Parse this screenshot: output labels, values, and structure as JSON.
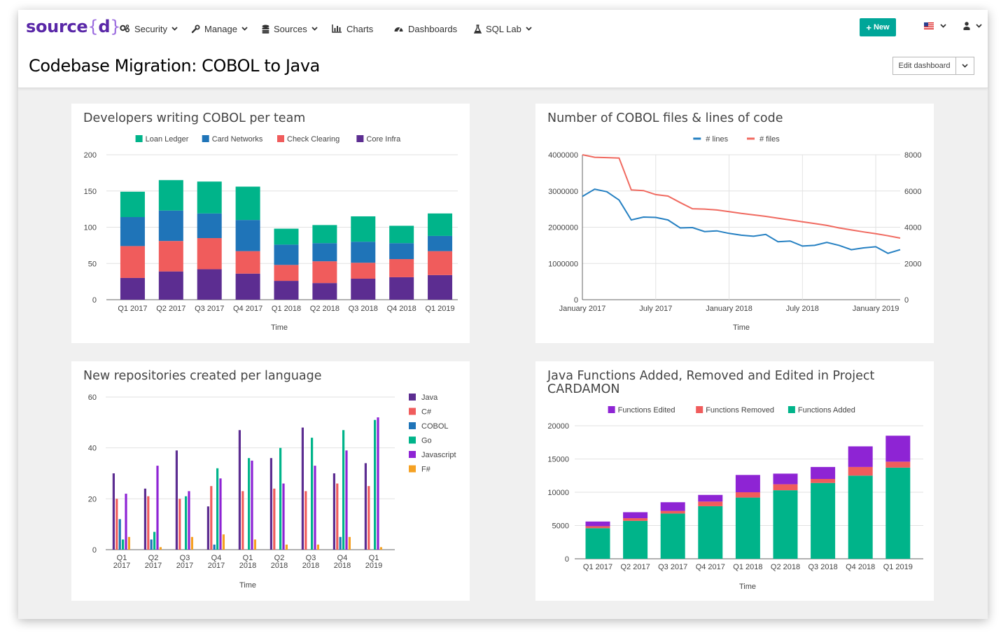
{
  "app": {
    "logo_prefix": "source",
    "logo_open": "{",
    "logo_mid": "d",
    "logo_close": "}",
    "nav": [
      {
        "label": "Security",
        "icon": "gears-icon",
        "has_caret": true
      },
      {
        "label": "Manage",
        "icon": "wrench-icon",
        "has_caret": true
      },
      {
        "label": "Sources",
        "icon": "database-icon",
        "has_caret": true
      },
      {
        "label": "Charts",
        "icon": "bar-chart-icon",
        "has_caret": false
      },
      {
        "label": "Dashboards",
        "icon": "dashboard-icon",
        "has_caret": false
      },
      {
        "label": "SQL Lab",
        "icon": "flask-icon",
        "has_caret": true
      }
    ],
    "new_button": "New",
    "language_icon": "us-flag-icon",
    "user_icon": "user-icon",
    "accent_color": "#00a699",
    "brand_color": "#5a28a8"
  },
  "dashboard": {
    "title": "Codebase Migration: COBOL to Java",
    "edit_button": "Edit dashboard"
  },
  "colors": {
    "teal": "#00b48a",
    "blue": "#1f74b8",
    "red": "#f05c5c",
    "purple": "#5c2d91",
    "line_blue": "#2580c2",
    "line_red": "#f06a60",
    "violet": "#8e24d4",
    "orange": "#f5a123"
  },
  "charts": {
    "dev_cobol": {
      "title": "Developers writing COBOL per team",
      "xlabel": "Time",
      "yticks": [
        "0",
        "50",
        "100",
        "150",
        "200"
      ]
    },
    "cobol_files": {
      "title": "Number of COBOL files & lines of code",
      "xlabel": "Time",
      "yticks_left": [
        "0",
        "1000000",
        "2000000",
        "3000000",
        "4000000"
      ],
      "yticks_right": [
        "0",
        "2000",
        "4000",
        "6000",
        "8000"
      ],
      "xticks": [
        "January 2017",
        "July 2017",
        "January 2018",
        "July 2018",
        "January 2019"
      ]
    },
    "new_repos": {
      "title": "New repositories created per language",
      "xlabel": "Time",
      "yticks": [
        "0",
        "20",
        "40",
        "60"
      ]
    },
    "java_funcs": {
      "title": "Java Functions Added, Removed and Edited in Project CARDAMON",
      "xlabel": "Time",
      "yticks": [
        "0",
        "5000",
        "10000",
        "15000",
        "20000"
      ]
    }
  },
  "chart_data": [
    {
      "type": "bar",
      "stacked": true,
      "title": "Developers writing COBOL per team",
      "xlabel": "Time",
      "ylabel": "",
      "ylim": [
        0,
        200
      ],
      "legend": "top",
      "categories": [
        "Q1 2017",
        "Q2 2017",
        "Q3 2017",
        "Q4 2017",
        "Q1 2018",
        "Q2 2018",
        "Q3 2018",
        "Q4 2018",
        "Q1 2019"
      ],
      "series": [
        {
          "name": "Core Infra",
          "color": "#5c2d91",
          "values": [
            30,
            39,
            42,
            36,
            26,
            23,
            29,
            31,
            34
          ]
        },
        {
          "name": "Check Clearing",
          "color": "#f05c5c",
          "values": [
            44,
            42,
            43,
            31,
            22,
            30,
            22,
            25,
            33
          ]
        },
        {
          "name": "Card Networks",
          "color": "#1f74b8",
          "values": [
            40,
            42,
            34,
            43,
            28,
            25,
            29,
            22,
            21
          ]
        },
        {
          "name": "Loan Ledger",
          "color": "#00b48a",
          "values": [
            35,
            42,
            44,
            46,
            22,
            25,
            35,
            24,
            31
          ]
        }
      ]
    },
    {
      "type": "line",
      "title": "Number of COBOL files & lines of code",
      "xlabel": "Time",
      "ylim": [
        0,
        4000000
      ],
      "y2lim": [
        0,
        8000
      ],
      "legend": "top",
      "x": [
        "2017-01",
        "2017-02",
        "2017-03",
        "2017-04",
        "2017-05",
        "2017-06",
        "2017-07",
        "2017-08",
        "2017-09",
        "2017-10",
        "2017-11",
        "2017-12",
        "2018-01",
        "2018-02",
        "2018-03",
        "2018-04",
        "2018-05",
        "2018-06",
        "2018-07",
        "2018-08",
        "2018-09",
        "2018-10",
        "2018-11",
        "2018-12",
        "2019-01",
        "2019-02",
        "2019-03"
      ],
      "series": [
        {
          "name": "# lines",
          "axis": "left",
          "color": "#2580c2",
          "values": [
            2850000,
            3050000,
            2980000,
            2750000,
            2200000,
            2280000,
            2270000,
            2200000,
            1980000,
            1990000,
            1880000,
            1900000,
            1830000,
            1780000,
            1750000,
            1800000,
            1600000,
            1620000,
            1480000,
            1500000,
            1580000,
            1500000,
            1380000,
            1430000,
            1460000,
            1280000,
            1380000
          ]
        },
        {
          "name": "# files",
          "axis": "right",
          "color": "#f06a60",
          "values": [
            8000,
            7860,
            7840,
            7820,
            6060,
            6020,
            5800,
            5720,
            5360,
            5020,
            5000,
            4950,
            4860,
            4760,
            4680,
            4600,
            4500,
            4400,
            4300,
            4200,
            4100,
            3960,
            3850,
            3740,
            3640,
            3530,
            3400
          ]
        }
      ]
    },
    {
      "type": "bar",
      "stacked": false,
      "title": "New repositories created per language",
      "xlabel": "Time",
      "ylim": [
        0,
        60
      ],
      "legend": "right",
      "categories": [
        "Q1 2017",
        "Q2 2017",
        "Q3 2017",
        "Q4 2017",
        "Q1 2018",
        "Q2 2018",
        "Q3 2018",
        "Q4 2018",
        "Q1 2019"
      ],
      "series": [
        {
          "name": "Java",
          "color": "#5c2d91",
          "values": [
            30,
            24,
            39,
            17,
            47,
            36,
            48,
            30,
            34
          ]
        },
        {
          "name": "C#",
          "color": "#f05c5c",
          "values": [
            20,
            21,
            20,
            25,
            23,
            24,
            23,
            26,
            25
          ]
        },
        {
          "name": "COBOL",
          "color": "#1f74b8",
          "values": [
            12,
            4,
            0,
            2,
            0,
            0,
            0,
            5,
            0
          ]
        },
        {
          "name": "Go",
          "color": "#00b48a",
          "values": [
            4,
            7,
            21,
            32,
            36,
            40,
            44,
            47,
            51
          ]
        },
        {
          "name": "Javascript",
          "color": "#8e24d4",
          "values": [
            22,
            33,
            23,
            28,
            35,
            26,
            33,
            39,
            52
          ]
        },
        {
          "name": "F#",
          "color": "#f5a123",
          "values": [
            5,
            1,
            5,
            6,
            4,
            2,
            2,
            5,
            1
          ]
        }
      ]
    },
    {
      "type": "bar",
      "stacked": true,
      "title": "Java Functions Added, Removed and Edited in Project CARDAMON",
      "xlabel": "Time",
      "ylim": [
        0,
        20000
      ],
      "legend": "top",
      "categories": [
        "Q1 2017",
        "Q2 2017",
        "Q3 2017",
        "Q4 2017",
        "Q1 2018",
        "Q2 2018",
        "Q3 2018",
        "Q4 2018",
        "Q1 2019"
      ],
      "series": [
        {
          "name": "Functions Added",
          "color": "#00b48a",
          "values": [
            4600,
            5700,
            6800,
            7900,
            9200,
            10300,
            11400,
            12500,
            13700
          ]
        },
        {
          "name": "Functions Removed",
          "color": "#f05c5c",
          "values": [
            300,
            400,
            400,
            700,
            800,
            900,
            600,
            1300,
            900
          ]
        },
        {
          "name": "Functions Edited",
          "color": "#8e24d4",
          "values": [
            700,
            900,
            1300,
            1000,
            2600,
            1600,
            1800,
            3100,
            3900
          ]
        }
      ]
    }
  ]
}
